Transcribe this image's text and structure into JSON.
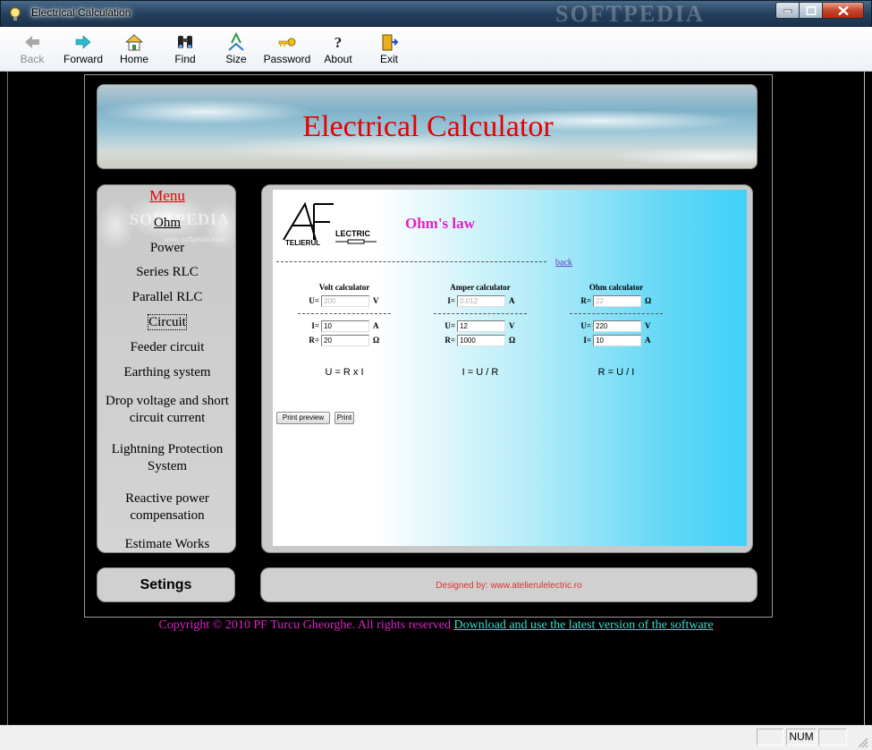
{
  "window": {
    "title": "Electrical Calculation",
    "watermark": "SOFTPEDIA"
  },
  "toolbar": {
    "buttons": [
      {
        "label": "Back",
        "icon": "back-arrow-icon",
        "enabled": false
      },
      {
        "label": "Forward",
        "icon": "forward-arrow-icon",
        "enabled": true
      },
      {
        "label": "Home",
        "icon": "home-icon",
        "enabled": true
      },
      {
        "label": "Find",
        "icon": "binoculars-icon",
        "enabled": true
      },
      {
        "label": "Size",
        "icon": "font-size-icon",
        "enabled": true
      },
      {
        "label": "Password",
        "icon": "key-icon",
        "enabled": true
      },
      {
        "label": "About",
        "icon": "question-icon",
        "enabled": true
      },
      {
        "label": "Exit",
        "icon": "exit-door-icon",
        "enabled": true
      }
    ]
  },
  "banner": {
    "title": "Electrical Calculator"
  },
  "menu": {
    "heading": "Menu",
    "watermark": "SOFTPEDIA",
    "watermark_small": "www.softpedia.com",
    "items": [
      {
        "label": "Ohm"
      },
      {
        "label": "Power"
      },
      {
        "label": "Series RLC"
      },
      {
        "label": "Parallel RLC"
      },
      {
        "label": "Circuit"
      },
      {
        "label": "Feeder circuit"
      },
      {
        "label": "Earthing system"
      },
      {
        "label": "Drop voltage and short circuit current"
      },
      {
        "label": "Lightning Protection System"
      },
      {
        "label": "Reactive power compensation"
      },
      {
        "label": "Estimate Works"
      }
    ]
  },
  "main": {
    "logo_text_top": "LECTRIC",
    "logo_text_bottom": "TELIERUL",
    "page_title": "Ohm's law",
    "back_link": "back",
    "calculators": [
      {
        "heading": "Volt calculator",
        "result": {
          "label": "U=",
          "value": "200",
          "unit": "V"
        },
        "inputs": [
          {
            "label": "I=",
            "value": "10",
            "unit": "A"
          },
          {
            "label": "R=",
            "value": "20",
            "unit": "Ω"
          }
        ],
        "formula": "U = R x I"
      },
      {
        "heading": "Amper calculator",
        "result": {
          "label": "I=",
          "value": "0.012",
          "unit": "A"
        },
        "inputs": [
          {
            "label": "U=",
            "value": "12",
            "unit": "V"
          },
          {
            "label": "R=",
            "value": "1000",
            "unit": "Ω"
          }
        ],
        "formula": "I = U / R"
      },
      {
        "heading": "Ohm calculator",
        "result": {
          "label": "R=",
          "value": "22",
          "unit": "Ω"
        },
        "inputs": [
          {
            "label": "U=",
            "value": "220",
            "unit": "V"
          },
          {
            "label": "I=",
            "value": "10",
            "unit": "A"
          }
        ],
        "formula": "R = U / I"
      }
    ],
    "print_preview_label": "Print preview",
    "print_label": "Print"
  },
  "settings": {
    "label": "Setings"
  },
  "footer": {
    "designed_by": "Designed by: www.atelierulelectric.ro",
    "copyright": "Copyright © 2010 PF Turcu Gheorghe. All rights reserved",
    "download_link": "Download and use the latest version of the software"
  },
  "statusbar": {
    "num": "NUM"
  }
}
